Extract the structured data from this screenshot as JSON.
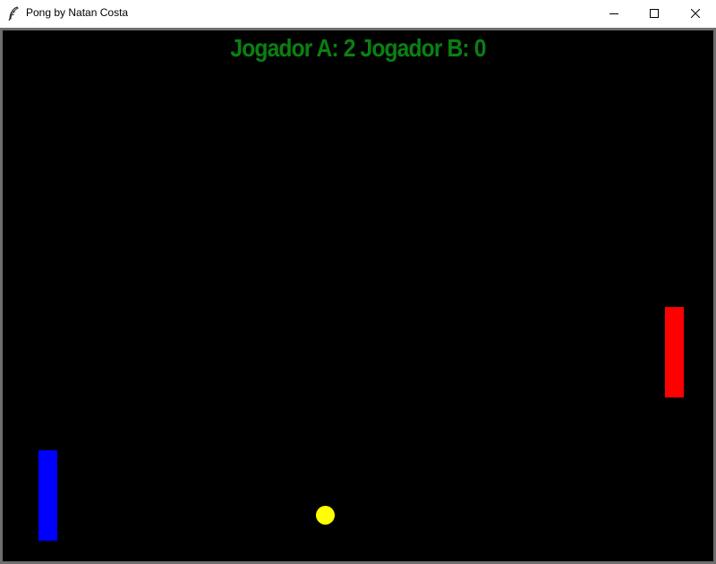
{
  "window": {
    "title": "Pong by Natan Costa"
  },
  "icons": {
    "app": "feather-icon",
    "minimize": "minimize-icon",
    "maximize": "maximize-icon",
    "close": "close-icon"
  },
  "game": {
    "score_text": "Jogador A: 2 Jogador B: 0",
    "player_a_score": 2,
    "player_b_score": 0,
    "colors": {
      "background": "#000000",
      "score": "#0a8010",
      "paddle_a": "#0000ff",
      "paddle_b": "#ff0000",
      "ball": "#ffff00"
    }
  }
}
